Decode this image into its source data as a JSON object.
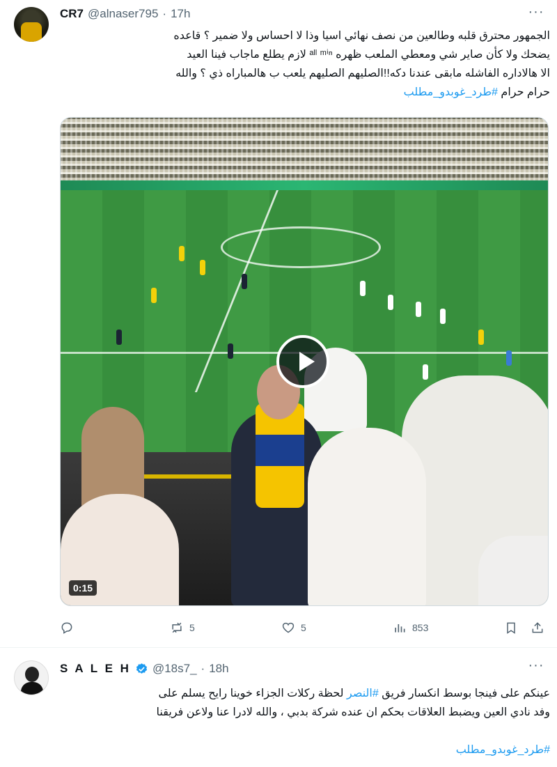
{
  "tweet1": {
    "name": "CR7",
    "handle": "@alnaser795",
    "separator": "·",
    "time": "17h",
    "more": "···",
    "lines": [
      "الجمهور محترق قلبه وطالعين من نصف نهائي اسيا وذا لا احساس ولا ضمير ؟ قاعده",
      "يضحك ولا كأن صاير شي ومعطي الملعب ظهره ᵃˡˡ ᵐⁱⁿ لازم يطلع ماجاب فينا العيد",
      "الا هالاداره الفاشله مابقى عندنا دكه!!الصليهم الصليهم يلعب ب هالمباراه ذي ؟ والله"
    ],
    "last_line_prefix": "حرام حرام",
    "hashtag": "#طرد_غوبدو_مطلب",
    "video_duration": "0:15",
    "stats": {
      "replies": "",
      "reposts": "5",
      "likes": "5",
      "views": "853"
    }
  },
  "tweet2": {
    "name": "S A L E H",
    "handle": "@18s7_",
    "separator": "·",
    "time": "18h",
    "more": "···",
    "line1_prefix": "عينكم على فينجا بوسط انكسار فريق",
    "line1_hashtag": "#النصر",
    "line1_suffix": "لحظة ركلات الجزاء خوينا رايح يسلم على",
    "line2": "وفد نادي العين ويضبط العلاقات بحكم ان عنده شركة بدبي ، والله لادرا عنا ولاعن فريقنا",
    "hashtag": "#طرد_غوبدو_مطلب"
  },
  "colors": {
    "link": "#1d9bf0",
    "muted": "#536471",
    "verified": "#1d9bf0"
  }
}
